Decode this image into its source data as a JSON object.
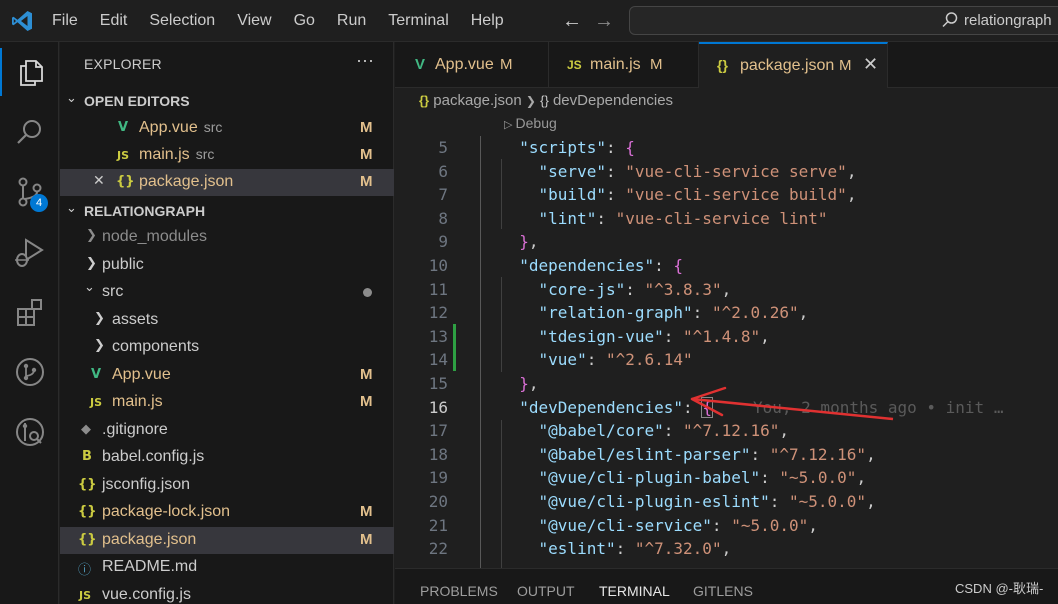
{
  "menu": [
    "File",
    "Edit",
    "Selection",
    "View",
    "Go",
    "Run",
    "Terminal",
    "Help"
  ],
  "search": {
    "text": "relationgraph"
  },
  "activity_bar": {
    "scm_badge": "4"
  },
  "sidebar": {
    "title": "EXPLORER",
    "more": "···",
    "open_editors": {
      "header": "OPEN EDITORS",
      "items": [
        {
          "icon": "V",
          "name": "App.vue",
          "folder": "src",
          "status": "M"
        },
        {
          "icon": "JS",
          "name": "main.js",
          "folder": "src",
          "status": "M"
        },
        {
          "icon": "{}",
          "name": "package.json",
          "folder": "",
          "status": "M",
          "close": "✕"
        }
      ]
    },
    "project": {
      "header": "RELATIONGRAPH",
      "items": [
        {
          "name": "node_modules",
          "chev": "❯"
        },
        {
          "name": "public",
          "chev": "❯"
        },
        {
          "name": "src",
          "chev": "⌄"
        },
        {
          "name": "assets",
          "chev": "❯"
        },
        {
          "name": "components",
          "chev": "❯"
        },
        {
          "icon": "V",
          "name": "App.vue",
          "status": "M"
        },
        {
          "icon": "JS",
          "name": "main.js",
          "status": "M"
        },
        {
          "icon": "◆",
          "name": ".gitignore"
        },
        {
          "icon": "B",
          "name": "babel.config.js"
        },
        {
          "icon": "{}",
          "name": "jsconfig.json"
        },
        {
          "icon": "{}",
          "name": "package-lock.json",
          "status": "M"
        },
        {
          "icon": "{}",
          "name": "package.json",
          "status": "M"
        },
        {
          "icon": "ⓘ",
          "name": "README.md"
        },
        {
          "icon": "JS",
          "name": "vue.config.js"
        }
      ]
    }
  },
  "tabs": [
    {
      "icon": "V",
      "name": "App.vue",
      "status": "M"
    },
    {
      "icon": "JS",
      "name": "main.js",
      "status": "M"
    },
    {
      "icon": "{}",
      "name": "package.json",
      "status": "M",
      "close": "✕"
    }
  ],
  "breadcrumb": {
    "file": "package.json",
    "sep": "❯",
    "section": "devDependencies",
    "file_icon": "{}",
    "section_icon": "{}"
  },
  "codelens": "Debug",
  "code_lines": [
    {
      "n": "5",
      "text": "  \"scripts\": {"
    },
    {
      "n": "6",
      "text": "    \"serve\": \"vue-cli-service serve\","
    },
    {
      "n": "7",
      "text": "    \"build\": \"vue-cli-service build\","
    },
    {
      "n": "8",
      "text": "    \"lint\": \"vue-cli-service lint\""
    },
    {
      "n": "9",
      "text": "  },"
    },
    {
      "n": "10",
      "text": "  \"dependencies\": {"
    },
    {
      "n": "11",
      "text": "    \"core-js\": \"^3.8.3\","
    },
    {
      "n": "12",
      "text": "    \"relation-graph\": \"^2.0.26\","
    },
    {
      "n": "13",
      "text": "    \"tdesign-vue\": \"^1.4.8\","
    },
    {
      "n": "14",
      "text": "    \"vue\": \"^2.6.14\""
    },
    {
      "n": "15",
      "text": "  },"
    },
    {
      "n": "16",
      "text": "  \"devDependencies\": {"
    },
    {
      "n": "17",
      "text": "    \"@babel/core\": \"^7.12.16\","
    },
    {
      "n": "18",
      "text": "    \"@babel/eslint-parser\": \"^7.12.16\","
    },
    {
      "n": "19",
      "text": "    \"@vue/cli-plugin-babel\": \"~5.0.0\","
    },
    {
      "n": "20",
      "text": "    \"@vue/cli-plugin-eslint\": \"~5.0.0\","
    },
    {
      "n": "21",
      "text": "    \"@vue/cli-service\": \"~5.0.0\","
    },
    {
      "n": "22",
      "text": "    \"eslint\": \"^7.32.0\","
    }
  ],
  "blame": "You, 2 months ago • init …",
  "panel_tabs": [
    "PROBLEMS",
    "OUTPUT",
    "TERMINAL",
    "GITLENS"
  ],
  "panel_active": "TERMINAL",
  "watermark": "CSDN @-耿瑞-",
  "colors": {
    "accent": "#0078d4",
    "modified": "#e2c08d",
    "arrow": "#e03131",
    "git_added": "#2ea043"
  }
}
